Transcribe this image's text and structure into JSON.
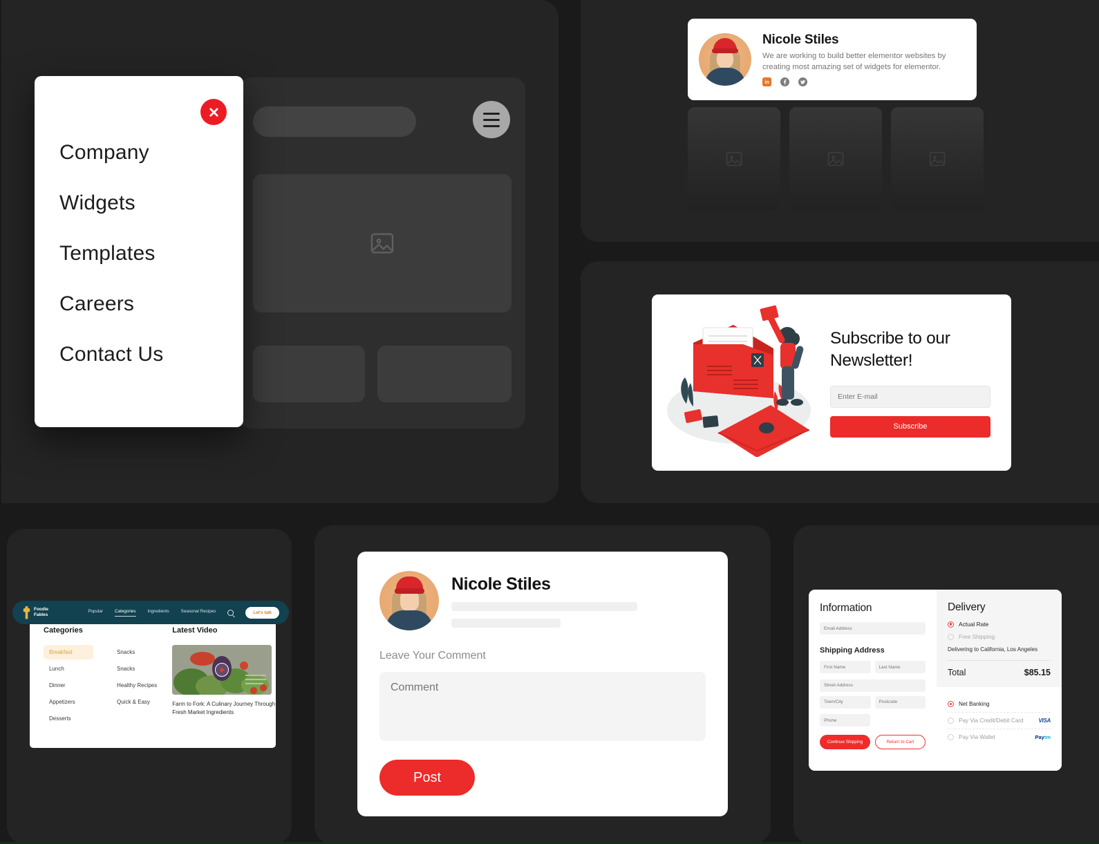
{
  "theme": {
    "background": "#1a1a1a",
    "panel": "#242424",
    "accent_red": "#ec2b2b",
    "teal": "#12414f",
    "gold": "#e8b53c"
  },
  "menu_panel": {
    "close_label": "Close",
    "items": [
      {
        "label": "Company"
      },
      {
        "label": "Widgets"
      },
      {
        "label": "Templates"
      },
      {
        "label": "Careers"
      },
      {
        "label": "Contact Us"
      }
    ]
  },
  "profile": {
    "name": "Nicole Stiles",
    "bio": "We are working to build better elementor websites by creating most amazing set of widgets for elementor.",
    "socials": [
      {
        "name": "linkedin",
        "color": "#e8762c"
      },
      {
        "name": "facebook",
        "color": "#7d7d7d"
      },
      {
        "name": "twitter",
        "color": "#7d7d7d"
      }
    ],
    "gallery": [
      {
        "alt": "image-placeholder-1"
      },
      {
        "alt": "image-placeholder-2"
      },
      {
        "alt": "image-placeholder-3"
      }
    ]
  },
  "newsletter": {
    "title": "Subscribe to our Newsletter!",
    "email_placeholder": "Enter E-mail",
    "email_value": "",
    "button_label": "Subscribe"
  },
  "foodie": {
    "logo_line1": "Foodie",
    "logo_line2": "Fables",
    "nav": [
      {
        "label": "Popular",
        "active": false
      },
      {
        "label": "Categories",
        "active": true
      },
      {
        "label": "Ingredients",
        "active": false
      },
      {
        "label": "Seasonal Recipes",
        "active": false
      }
    ],
    "cta_label": "Let's talk",
    "categories_heading": "Categories",
    "categories_col1": [
      {
        "label": "Breakfast",
        "active": true
      },
      {
        "label": "Lunch",
        "active": false
      },
      {
        "label": "Dinner",
        "active": false
      },
      {
        "label": "Appetizers",
        "active": false
      },
      {
        "label": "Desserts",
        "active": false
      }
    ],
    "categories_col2": [
      {
        "label": "Snacks",
        "active": false
      },
      {
        "label": "Snacks",
        "active": false
      },
      {
        "label": "Healthy Recipes",
        "active": false
      },
      {
        "label": "Quick & Easy",
        "active": false
      }
    ],
    "video_heading": "Latest Video",
    "video_caption": "Farm to Fork: A Culinary Journey Through Fresh Market Ingredients"
  },
  "comment": {
    "name": "Nicole Stiles",
    "label": "Leave Your Comment",
    "placeholder": "Comment",
    "value": "",
    "post_label": "Post"
  },
  "checkout": {
    "information_heading": "Information",
    "email_placeholder": "Email Address",
    "shipping_heading": "Shipping Address",
    "first_name_placeholder": "First Name",
    "last_name_placeholder": "Last Name",
    "street_placeholder": "Street Address",
    "town_placeholder": "Town/City",
    "postcode_placeholder": "Postcode",
    "phone_placeholder": "Phone",
    "continue_label": "Continue Shipping",
    "return_label": "Return to Cart",
    "delivery_heading": "Delivery",
    "delivery_options": [
      {
        "label": "Actual Rate",
        "selected": true
      },
      {
        "label": "Free Shipping",
        "selected": false
      }
    ],
    "delivering_to": "Delivering to California, Los Angeles",
    "total_label": "Total",
    "total_value": "$85.15",
    "payment_options": [
      {
        "label": "Net Banking",
        "selected": true,
        "badge": ""
      },
      {
        "label": "Pay Via Credit/Debit Card",
        "selected": false,
        "badge": "VISA"
      },
      {
        "label": "Pay Via Wallet",
        "selected": false,
        "badge": "Paytm"
      }
    ]
  }
}
